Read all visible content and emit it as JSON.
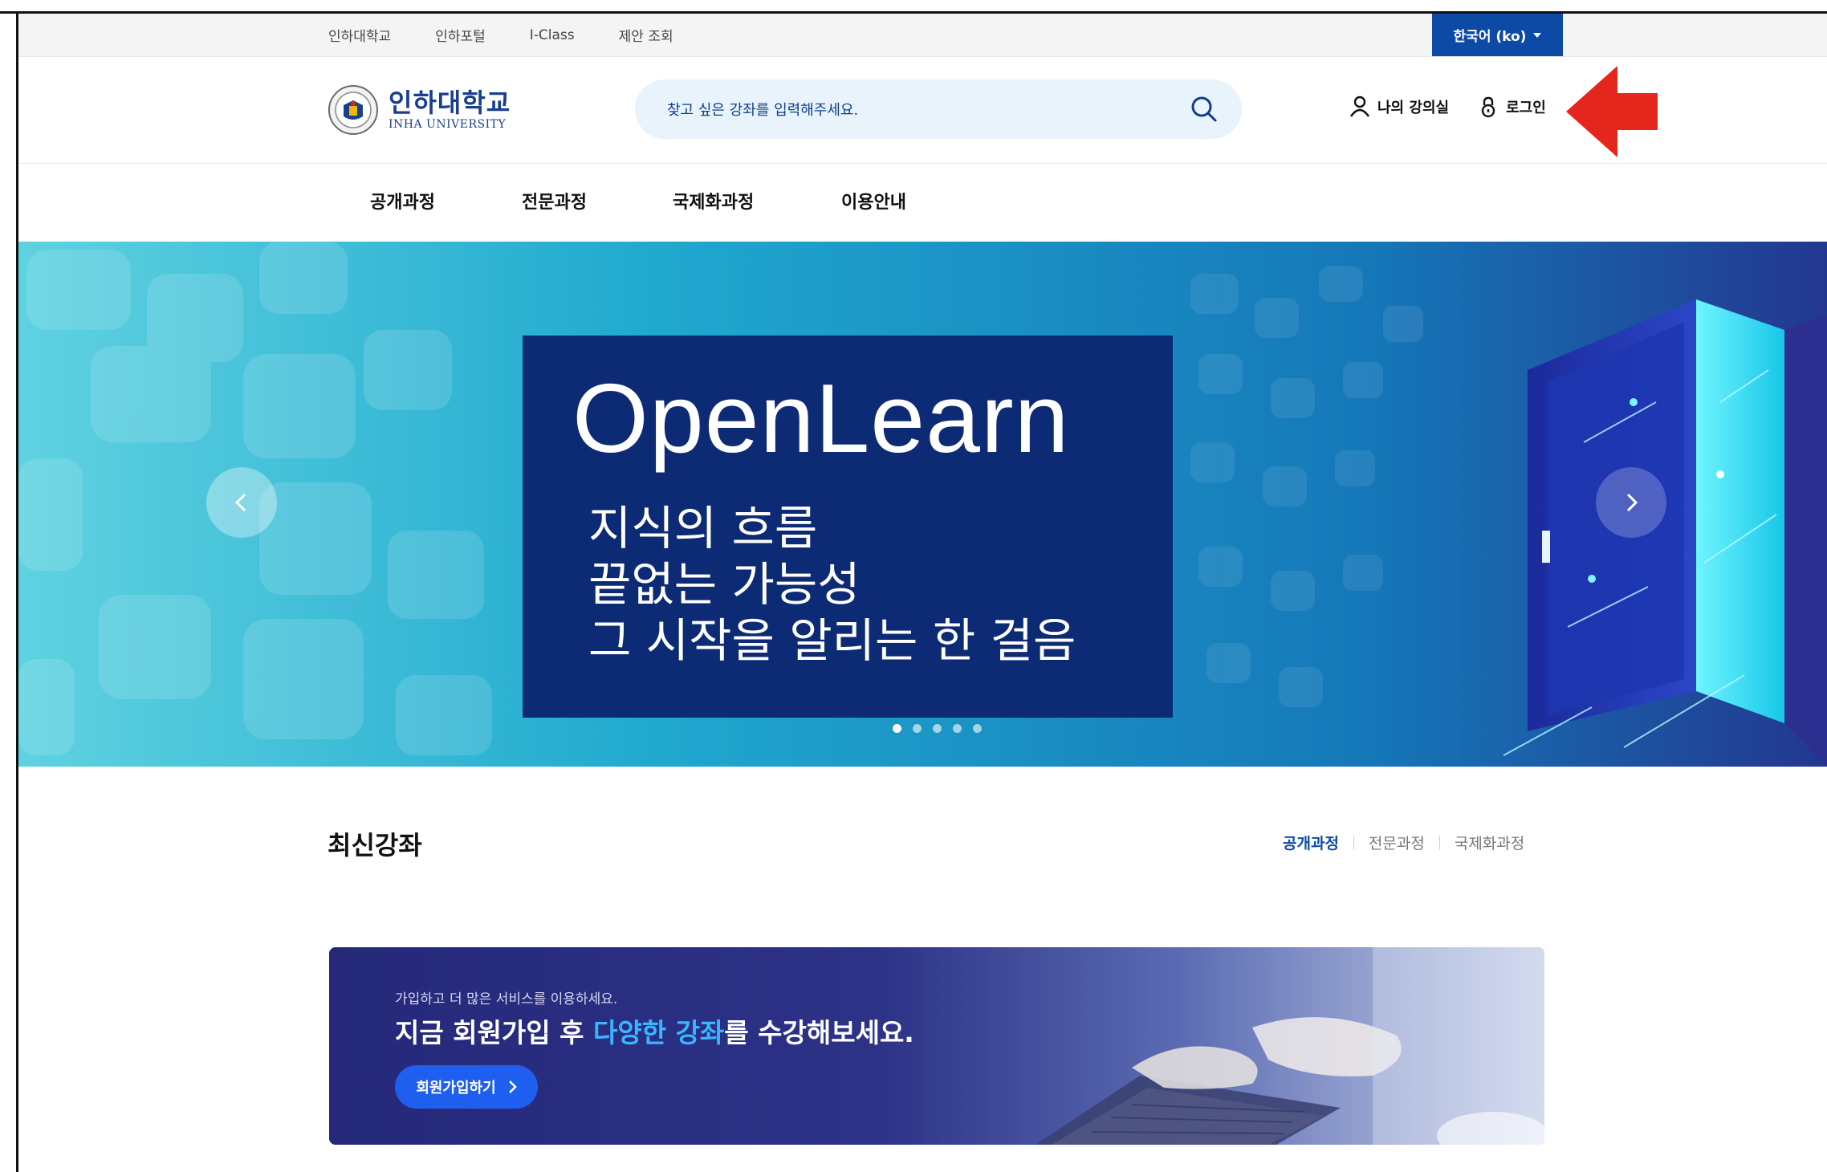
{
  "utility_bar": {
    "links": [
      "인하대학교",
      "인하포털",
      "I-Class",
      "제안 조회"
    ],
    "language": "한국어 (ko)"
  },
  "header": {
    "logo_ko": "인하대학교",
    "logo_en": "INHA UNIVERSITY",
    "search_placeholder": "찾고 싶은 강좌를 입력해주세요.",
    "my_classroom": "나의 강의실",
    "login": "로그인"
  },
  "nav": {
    "items": [
      "공개과정",
      "전문과정",
      "국제화과정",
      "이용안내"
    ]
  },
  "hero": {
    "title": "OpenLearn",
    "subtitle_lines": [
      "지식의 흐름",
      "끝없는 가능성",
      "그 시작을 알리는 한 걸음"
    ],
    "slide_count": 5,
    "active_slide": 1
  },
  "latest": {
    "title": "최신강좌",
    "tabs": [
      "공개과정",
      "전문과정",
      "국제화과정"
    ],
    "active_tab": "공개과정"
  },
  "signup_banner": {
    "small_text": "가입하고 더 많은 서비스를 이용하세요.",
    "headline_pre": "지금 회원가입 후 ",
    "headline_highlight": "다양한 강좌",
    "headline_post": "를 수강해보세요.",
    "button": "회원가입하기"
  },
  "colors": {
    "primary": "#0d4aa5",
    "search_bg": "#e9f3fc",
    "hero_panel": "#0c2b74",
    "highlight": "#39b6ff",
    "annotation_arrow": "#e5261c"
  },
  "icons": [
    "search-icon",
    "user-icon",
    "lock-icon",
    "chevron-left-icon",
    "chevron-right-icon",
    "chevron-right-icon",
    "annotation-arrow-icon"
  ]
}
